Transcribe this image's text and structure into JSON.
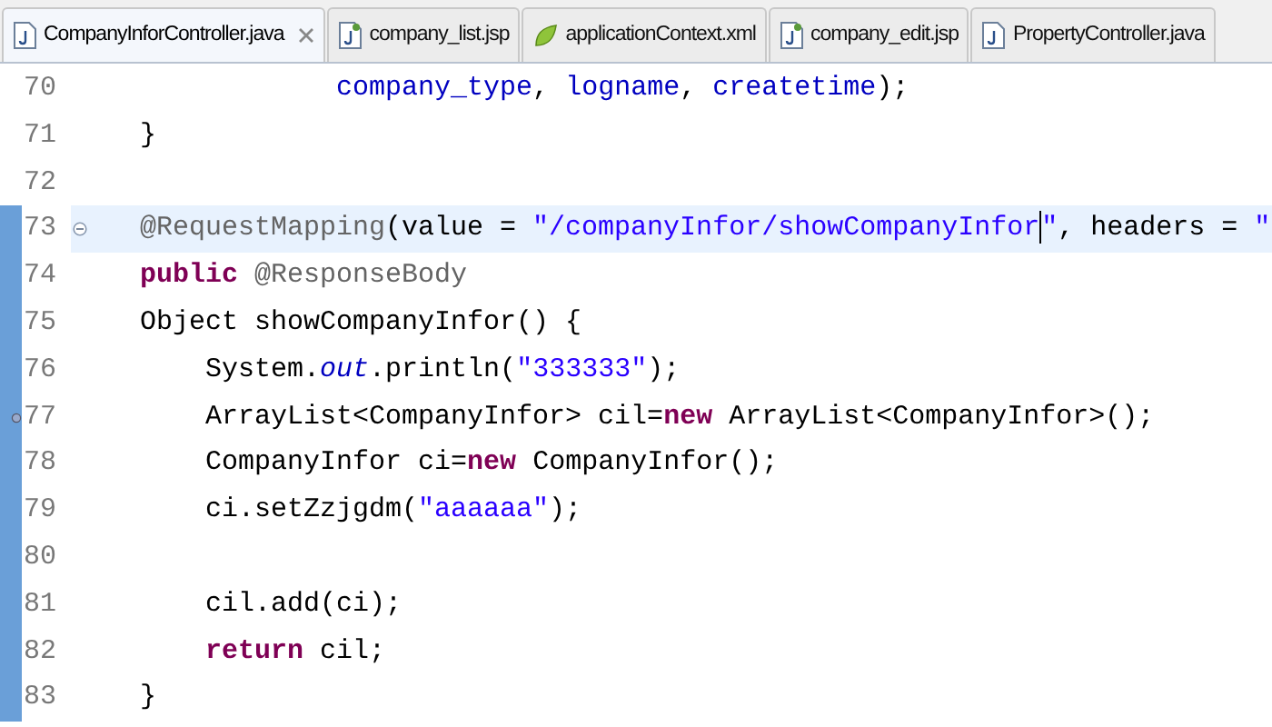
{
  "tabs": [
    {
      "label": "CompanyInforController.java",
      "kind": "java",
      "selected": true
    },
    {
      "label": "company_list.jsp",
      "kind": "jsp",
      "selected": false
    },
    {
      "label": "applicationContext.xml",
      "kind": "xml",
      "selected": false
    },
    {
      "label": "company_edit.jsp",
      "kind": "jsp",
      "selected": false
    },
    {
      "label": "PropertyController.java",
      "kind": "java",
      "selected": false
    }
  ],
  "lines": [
    {
      "number": "70",
      "kind": "plain",
      "current": false,
      "scope": false,
      "tokens": [
        {
          "kind": "field",
          "text": "                company_type"
        },
        {
          "kind": "plain",
          "text": ", "
        },
        {
          "kind": "field",
          "text": "logname"
        },
        {
          "kind": "plain",
          "text": ", "
        },
        {
          "kind": "field",
          "text": "createtime"
        },
        {
          "kind": "plain",
          "text": ");"
        }
      ]
    },
    {
      "number": "71",
      "kind": "plain",
      "current": false,
      "scope": false,
      "tokens": [
        {
          "kind": "plain",
          "text": "    }"
        }
      ]
    },
    {
      "number": "72",
      "kind": "plain",
      "current": false,
      "scope": false
    },
    {
      "number": "73",
      "kind": "fold",
      "current": true,
      "scope": true,
      "tokens": [
        {
          "kind": "annotation",
          "text": "    @RequestMapping"
        },
        {
          "kind": "plain",
          "text": "(value = "
        },
        {
          "kind": "string",
          "text": "\"/companyInfor/showCompanyInfor",
          "caret": true
        },
        {
          "kind": "string",
          "text": "\""
        },
        {
          "kind": "plain",
          "text": ", headers = "
        },
        {
          "kind": "string",
          "text": "\""
        }
      ]
    },
    {
      "number": "74",
      "kind": "plain",
      "current": false,
      "scope": true,
      "tokens": [
        {
          "kind": "keyword",
          "text": "    public"
        },
        {
          "kind": "annotation",
          "text": " @ResponseBody"
        }
      ]
    },
    {
      "number": "75",
      "kind": "plain",
      "current": false,
      "scope": true,
      "tokens": [
        {
          "kind": "plain",
          "text": "    Object showCompanyInfor() {"
        }
      ]
    },
    {
      "number": "76",
      "kind": "plain",
      "current": false,
      "scope": true,
      "tokens": [
        {
          "kind": "plain",
          "text": "        System."
        },
        {
          "kind": "static",
          "text": "out"
        },
        {
          "kind": "plain",
          "text": ".println("
        },
        {
          "kind": "string",
          "text": "\"333333\""
        },
        {
          "kind": "plain",
          "text": ");"
        }
      ]
    },
    {
      "number": "77",
      "kind": "marker",
      "current": false,
      "scope": true,
      "tokens": [
        {
          "kind": "plain",
          "text": "        ArrayList<CompanyInfor> cil="
        },
        {
          "kind": "keyword",
          "text": "new"
        },
        {
          "kind": "plain",
          "text": " ArrayList<CompanyInfor>();"
        }
      ]
    },
    {
      "number": "78",
      "kind": "plain",
      "current": false,
      "scope": true,
      "tokens": [
        {
          "kind": "plain",
          "text": "        CompanyInfor ci="
        },
        {
          "kind": "keyword",
          "text": "new"
        },
        {
          "kind": "plain",
          "text": " CompanyInfor();"
        }
      ]
    },
    {
      "number": "79",
      "kind": "plain",
      "current": false,
      "scope": true,
      "tokens": [
        {
          "kind": "plain",
          "text": "        ci.setZzjgdm("
        },
        {
          "kind": "string",
          "text": "\"aaaaaa\""
        },
        {
          "kind": "plain",
          "text": ");"
        }
      ]
    },
    {
      "number": "80",
      "kind": "plain",
      "current": false,
      "scope": true
    },
    {
      "number": "81",
      "kind": "plain",
      "current": false,
      "scope": true,
      "tokens": [
        {
          "kind": "plain",
          "text": "        cil.add(ci);"
        }
      ]
    },
    {
      "number": "82",
      "kind": "plain",
      "current": false,
      "scope": true,
      "tokens": [
        {
          "kind": "keyword",
          "text": "        return"
        },
        {
          "kind": "plain",
          "text": " cil;"
        }
      ]
    },
    {
      "number": "83",
      "kind": "plain",
      "current": false,
      "scope": true,
      "tokens": [
        {
          "kind": "plain",
          "text": "    }"
        }
      ]
    }
  ]
}
